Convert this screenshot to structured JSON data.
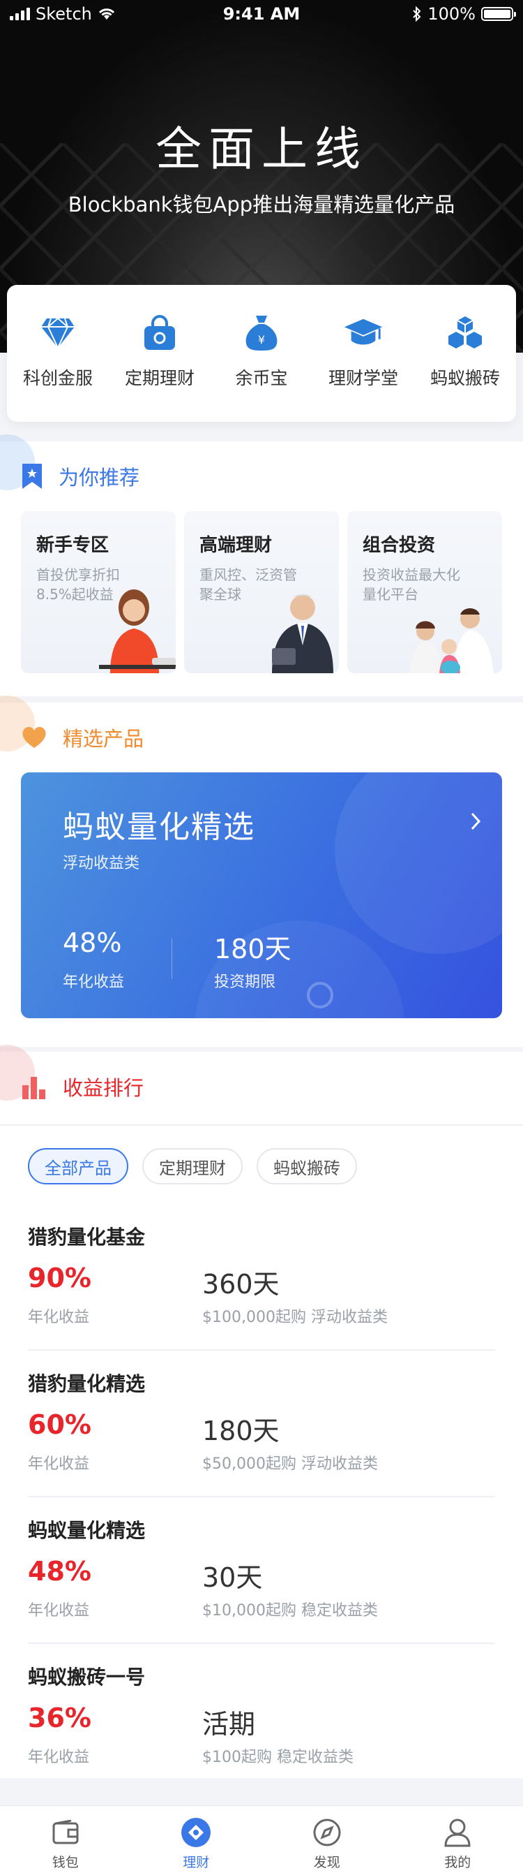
{
  "status_bar": {
    "carrier": "Sketch",
    "time": "9:41 AM",
    "battery": "100%"
  },
  "hero": {
    "title": "全面上线",
    "subtitle": "Blockbank钱包App推出海量精选量化产品"
  },
  "quick_menu": [
    {
      "label": "科创金服",
      "icon": "diamond-icon"
    },
    {
      "label": "定期理财",
      "icon": "lock-bag-icon"
    },
    {
      "label": "余币宝",
      "icon": "money-bag-icon"
    },
    {
      "label": "理财学堂",
      "icon": "graduation-cap-icon"
    },
    {
      "label": "蚂蚁搬砖",
      "icon": "blocks-icon"
    }
  ],
  "recommend": {
    "title": "为你推荐",
    "cards": [
      {
        "title": "新手专区",
        "desc": "首投优享折扣8.5%起收益"
      },
      {
        "title": "高端理财",
        "desc": "重风控、泛资管聚全球"
      },
      {
        "title": "组合投资",
        "desc": "投资收益最大化量化平台"
      }
    ]
  },
  "featured": {
    "title": "精选产品",
    "product": {
      "name": "蚂蚁量化精选",
      "type": "浮动收益类",
      "rate": "48%",
      "rate_label": "年化收益",
      "period": "180天",
      "period_label": "投资期限"
    }
  },
  "ranking": {
    "title": "收益排行",
    "filters": [
      "全部产品",
      "定期理财",
      "蚂蚁搬砖"
    ],
    "active_filter": "全部产品",
    "items": [
      {
        "name": "猎豹量化基金",
        "rate": "90%",
        "rate_label": "年化收益",
        "period": "360天",
        "detail": "$100,000起购 浮动收益类"
      },
      {
        "name": "猎豹量化精选",
        "rate": "60%",
        "rate_label": "年化收益",
        "period": "180天",
        "detail": "$50,000起购 浮动收益类"
      },
      {
        "name": "蚂蚁量化精选",
        "rate": "48%",
        "rate_label": "年化收益",
        "period": "30天",
        "detail": "$10,000起购 稳定收益类"
      },
      {
        "name": "蚂蚁搬砖一号",
        "rate": "36%",
        "rate_label": "年化收益",
        "period": "活期",
        "detail": "$100起购 稳定收益类"
      }
    ]
  },
  "tabbar": [
    {
      "label": "钱包",
      "icon": "wallet-icon"
    },
    {
      "label": "理财",
      "icon": "finance-icon",
      "active": true
    },
    {
      "label": "发现",
      "icon": "compass-icon"
    },
    {
      "label": "我的",
      "icon": "user-icon"
    }
  ],
  "colors": {
    "accent": "#3b78e7",
    "rate_red": "#e8252b",
    "orange": "#f08a2c",
    "recommend_blue": "#3b78e7"
  }
}
